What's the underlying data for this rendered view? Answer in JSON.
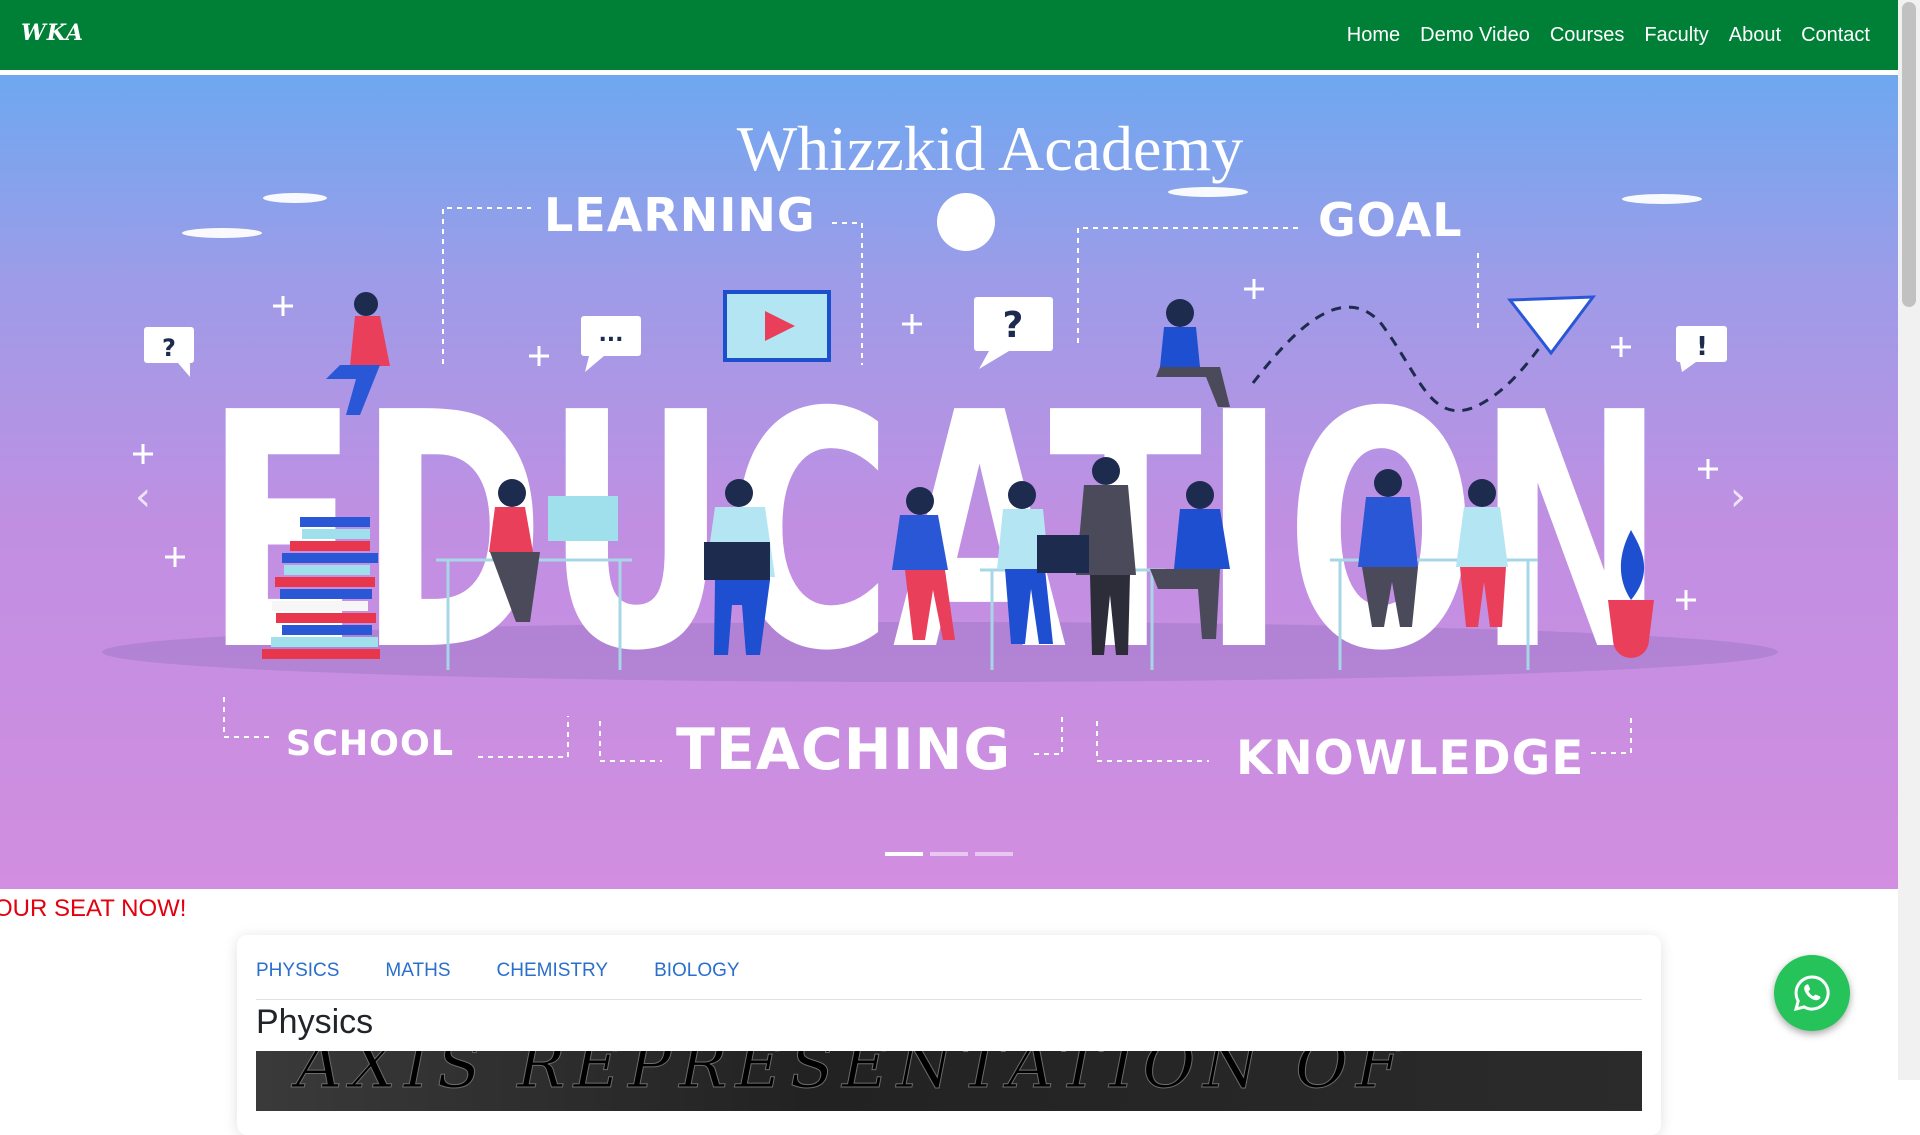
{
  "navbar": {
    "brand": "WKA",
    "links": [
      "Home",
      "Demo Video",
      "Courses",
      "Faculty",
      "About",
      "Contact"
    ]
  },
  "hero": {
    "title": "Whizzkid Academy",
    "words": {
      "learning": "LEARNING",
      "goal": "GOAL",
      "education": "EDUCATION",
      "school": "SCHOOL",
      "teaching": "TEACHING",
      "knowledge": "KNOWLEDGE"
    },
    "bubbles": [
      "?",
      "...",
      "?",
      "!"
    ],
    "prev_icon": "chevron-left-icon",
    "next_icon": "chevron-right-icon",
    "prev_glyph": "‹",
    "next_glyph": "›",
    "indicator_count": 3,
    "active_indicator": 1
  },
  "marquee": {
    "text": "OUR SEAT NOW!"
  },
  "subjects": {
    "tabs": [
      "PHYSICS",
      "MATHS",
      "CHEMISTRY",
      "BIOLOGY"
    ],
    "active_title": "Physics",
    "video_text": "AXIS REPRESENTATION OF"
  },
  "whatsapp": {
    "icon": "whatsapp-icon"
  },
  "colors": {
    "navbar": "#008037",
    "tab_text": "#2a6fcb",
    "marquee_text": "#e3000f",
    "whatsapp": "#25c35a"
  }
}
